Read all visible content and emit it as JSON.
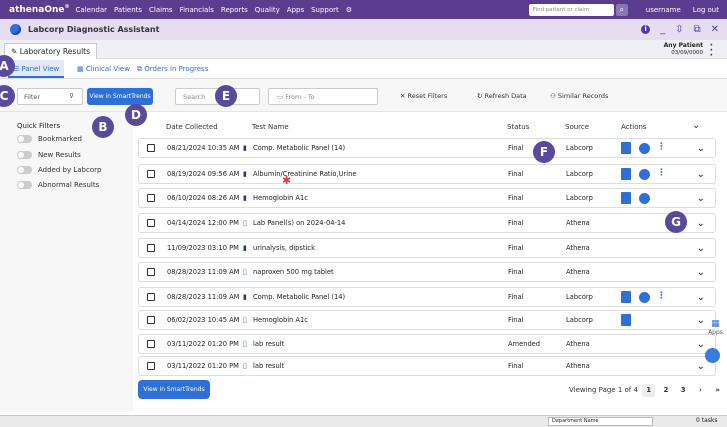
{
  "topnav": {
    "brand": "athenaOne",
    "brand_mark": "®",
    "items": [
      "Calendar",
      "Patients",
      "Claims",
      "Financials",
      "Reports",
      "Quality",
      "Apps",
      "Support"
    ],
    "find_placeholder": "Find patient or claim",
    "user": "username",
    "logout": "Log out"
  },
  "titlebar": {
    "title": "Labcorp Diagnostic Assistant"
  },
  "results": {
    "tab_label": "Laboratory Results"
  },
  "patient": {
    "name": "Any Patient",
    "dob": "03/09/0000"
  },
  "view_tabs": [
    {
      "label": "Panel View"
    },
    {
      "label": "Clinical View"
    },
    {
      "label": "Orders in Progress"
    }
  ],
  "toolbar": {
    "filter_label": "Filter",
    "smart_label": "View in SmartTrends",
    "search_placeholder": "Search",
    "date_placeholder": "From - To",
    "reset_label": "Reset Filters",
    "refresh_label": "Refresh Data",
    "similar_label": "Similar Records"
  },
  "quick_filters": {
    "title": "Quick Filters",
    "items": [
      "Bookmarked",
      "New Results",
      "Added by Labcorp",
      "Abnormal Results"
    ]
  },
  "table": {
    "headers": {
      "date": "Date Collected",
      "test": "Test Name",
      "status": "Status",
      "source": "Source",
      "actions": "Actions"
    },
    "rows": [
      {
        "date": "08/21/2024 10:35 AM",
        "test": "Comp. Metabolic Panel (14)",
        "status": "Final",
        "source": "Labcorp",
        "bookmark": "full",
        "actions": [
          "doc",
          "clock",
          "flow"
        ]
      },
      {
        "date": "08/19/2024 09:56 AM",
        "test": "Albumin/Creatinine Ratio,Urine",
        "status": "Final",
        "source": "Labcorp",
        "bookmark": "full",
        "actions": [
          "doc",
          "clock",
          "flow"
        ]
      },
      {
        "date": "06/10/2024 08:26 AM",
        "test": "Hemoglobin A1c",
        "status": "Final",
        "source": "Labcorp",
        "bookmark": "full",
        "actions": [
          "doc",
          "clock"
        ]
      },
      {
        "date": "04/14/2024 12:00 PM",
        "test": "Lab Panel(s) on 2024-04-14",
        "status": "Final",
        "source": "Athena",
        "bookmark": "empty",
        "actions": []
      },
      {
        "date": "11/09/2023 03:10 PM",
        "test": "urinalysis, dipstick",
        "status": "Final",
        "source": "Athena",
        "bookmark": "full",
        "actions": []
      },
      {
        "date": "08/28/2023 11:09 AM",
        "test": "naproxen 500 mg tablet",
        "status": "Final",
        "source": "Athena",
        "bookmark": "empty",
        "actions": []
      },
      {
        "date": "08/28/2023 11:09 AM",
        "test": "Comp. Metabolic Panel (14)",
        "status": "Final",
        "source": "Labcorp",
        "bookmark": "full",
        "actions": [
          "doc",
          "clock",
          "flow"
        ]
      },
      {
        "date": "06/02/2023 10:45 AM",
        "test": "Hemoglobin A1c",
        "status": "Final",
        "source": "Labcorp",
        "bookmark": "empty",
        "actions": [
          "doc"
        ]
      },
      {
        "date": "03/11/2022 01:20 PM",
        "test": "lab result",
        "status": "Amended",
        "source": "Athena",
        "bookmark": "empty",
        "actions": []
      },
      {
        "date": "03/11/2022 01:20 PM",
        "test": "lab result",
        "status": "Final",
        "source": "Athena",
        "bookmark": "empty",
        "actions": []
      }
    ]
  },
  "pager": {
    "text": "Viewing Page 1 of 4",
    "pages": [
      "1",
      "2",
      "3"
    ]
  },
  "apps_side": {
    "label": "Apps"
  },
  "bottombar": {
    "dept": "Department Name",
    "tasks": "0 tasks"
  },
  "markers": [
    "A",
    "B",
    "C",
    "D",
    "E",
    "F",
    "G"
  ],
  "colors": {
    "nav": "#5b3d8f",
    "accent": "#2f6fd8",
    "marker": "#5a4a9b",
    "annotation_star": "#e53935"
  }
}
